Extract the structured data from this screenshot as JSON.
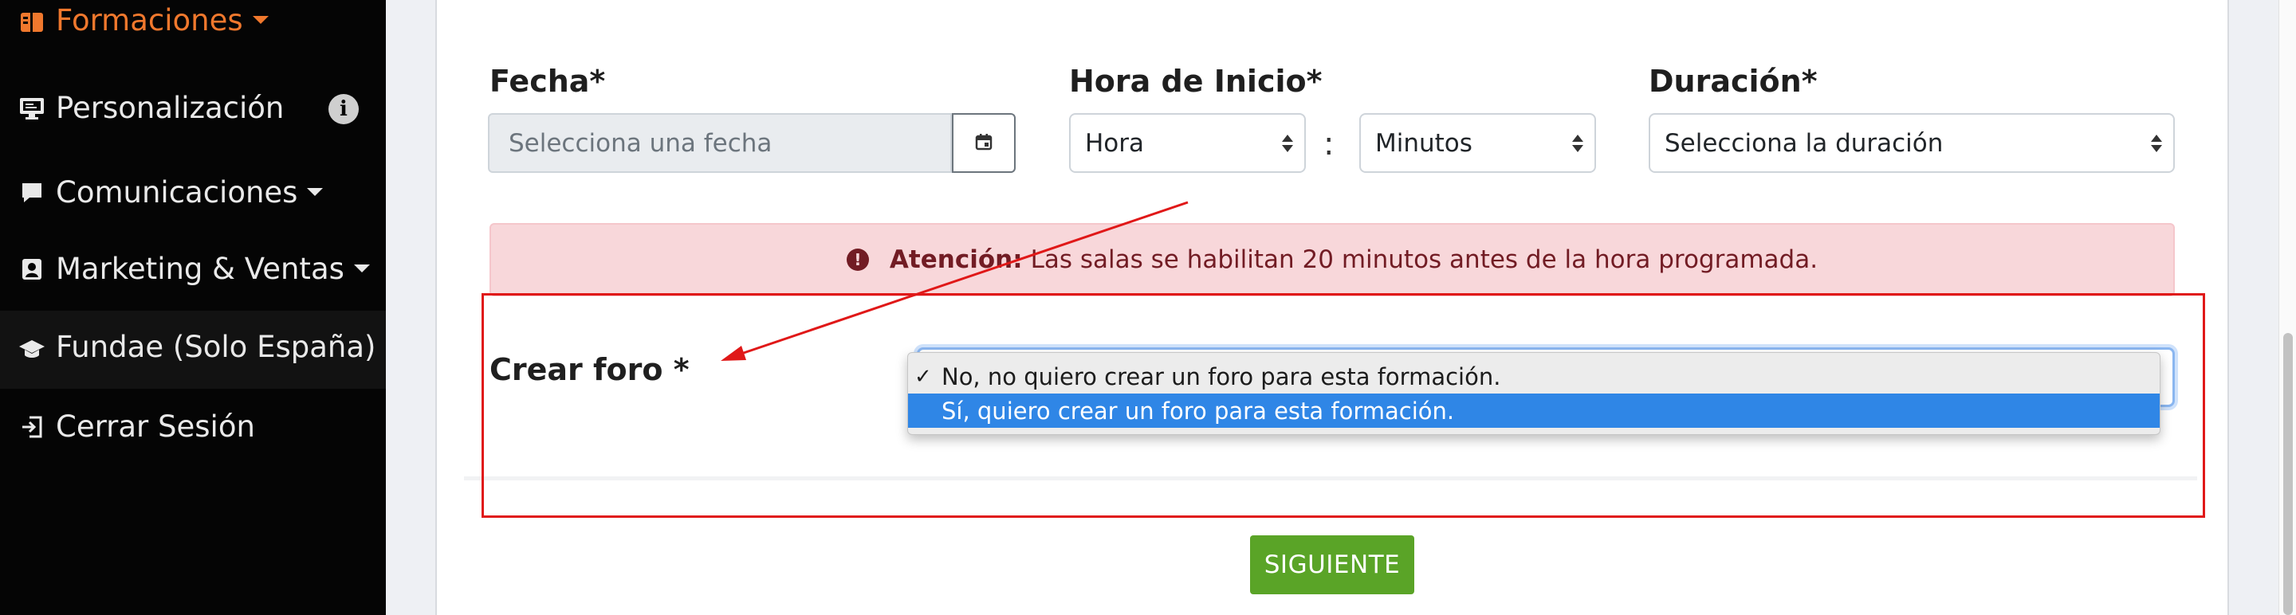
{
  "sidebar": {
    "items": [
      {
        "label": "Formaciones",
        "icon": "book-icon",
        "active": true
      },
      {
        "label": "Personalización",
        "icon": "monitor-icon"
      },
      {
        "label": "Comunicaciones",
        "icon": "chat-bubble-icon"
      },
      {
        "label": "Marketing & Ventas",
        "icon": "contact-card-icon"
      },
      {
        "label": "Fundae (Solo España)",
        "icon": "graduation-cap-icon"
      },
      {
        "label": "Cerrar Sesión",
        "icon": "logout-icon"
      }
    ],
    "info_badge": "i"
  },
  "form": {
    "date": {
      "label": "Fecha*",
      "placeholder": "Selecciona una fecha"
    },
    "start_time": {
      "label": "Hora de Inicio*",
      "hour": "Hora",
      "minutes": "Minutos",
      "separator": ":"
    },
    "duration": {
      "label": "Duración*",
      "value": "Selecciona la duración"
    },
    "alert": {
      "icon": "!",
      "strong": "Atención:",
      "text": "Las salas se habilitan 20 minutos antes de la hora programada."
    },
    "forum": {
      "label": "Crear foro *",
      "options": [
        {
          "check": "✓",
          "text": "No, no quiero crear un foro para esta formación."
        },
        {
          "check": "",
          "text": "Sí, quiero crear un foro para esta formación."
        }
      ]
    },
    "next_button": "SIGUIENTE"
  },
  "colors": {
    "accent": "#f0782d",
    "annotation_red": "#e01818",
    "button_green": "#5aa427",
    "highlight_blue": "#2f86e6"
  }
}
